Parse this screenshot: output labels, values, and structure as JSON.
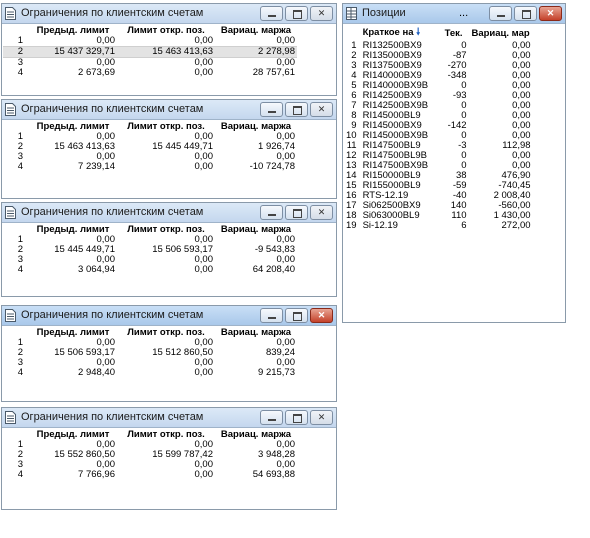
{
  "limit_windows": [
    {
      "title": "Ограничения по клиентским счетам",
      "headers": [
        "Предыд. лимит",
        "Лимит откр. поз.",
        "Вариац. маржа"
      ],
      "rows": [
        {
          "n": "1",
          "prev": "0,00",
          "open": "0,00",
          "var": "0,00"
        },
        {
          "n": "2",
          "prev": "15 437 329,71",
          "open": "15 463 413,63",
          "var": "2 278,98"
        },
        {
          "n": "3",
          "prev": "0,00",
          "open": "0,00",
          "var": "0,00"
        },
        {
          "n": "4",
          "prev": "2 673,69",
          "open": "0,00",
          "var": "28 757,61"
        }
      ]
    },
    {
      "title": "Ограничения по клиентским счетам",
      "headers": [
        "Предыд. лимит",
        "Лимит откр. поз.",
        "Вариац. маржа"
      ],
      "rows": [
        {
          "n": "1",
          "prev": "0,00",
          "open": "0,00",
          "var": "0,00"
        },
        {
          "n": "2",
          "prev": "15 463 413,63",
          "open": "15 445 449,71",
          "var": "1 926,74"
        },
        {
          "n": "3",
          "prev": "0,00",
          "open": "0,00",
          "var": "0,00"
        },
        {
          "n": "4",
          "prev": "7 239,14",
          "open": "0,00",
          "var": "-10 724,78"
        }
      ]
    },
    {
      "title": "Ограничения по клиентским счетам",
      "headers": [
        "Предыд. лимит",
        "Лимит откр. поз.",
        "Вариац. маржа"
      ],
      "rows": [
        {
          "n": "1",
          "prev": "0,00",
          "open": "0,00",
          "var": "0,00"
        },
        {
          "n": "2",
          "prev": "15 445 449,71",
          "open": "15 506 593,17",
          "var": "-9 543,83"
        },
        {
          "n": "3",
          "prev": "0,00",
          "open": "0,00",
          "var": "0,00"
        },
        {
          "n": "4",
          "prev": "3 064,94",
          "open": "0,00",
          "var": "64 208,40"
        }
      ]
    },
    {
      "title": "Ограничения по клиентским счетам",
      "headers": [
        "Предыд. лимит",
        "Лимит откр. поз.",
        "Вариац. маржа"
      ],
      "rows": [
        {
          "n": "1",
          "prev": "0,00",
          "open": "0,00",
          "var": "0,00"
        },
        {
          "n": "2",
          "prev": "15 506 593,17",
          "open": "15 512 860,50",
          "var": "839,24"
        },
        {
          "n": "3",
          "prev": "0,00",
          "open": "0,00",
          "var": "0,00"
        },
        {
          "n": "4",
          "prev": "2 948,40",
          "open": "0,00",
          "var": "9 215,73"
        }
      ]
    },
    {
      "title": "Ограничения по клиентским счетам",
      "headers": [
        "Предыд. лимит",
        "Лимит откр. поз.",
        "Вариац. маржа"
      ],
      "rows": [
        {
          "n": "1",
          "prev": "0,00",
          "open": "0,00",
          "var": "0,00"
        },
        {
          "n": "2",
          "prev": "15 552 860,50",
          "open": "15 599 787,42",
          "var": "3 948,28"
        },
        {
          "n": "3",
          "prev": "0,00",
          "open": "0,00",
          "var": "0,00"
        },
        {
          "n": "4",
          "prev": "7 766,96",
          "open": "0,00",
          "var": "54 693,88"
        }
      ]
    }
  ],
  "positions_window": {
    "title": "Позиции",
    "title_ellipsis": "...",
    "headers": [
      "Краткое на",
      "Тек.",
      "Вариац. мар"
    ],
    "sort_indicator": "🠗",
    "rows": [
      {
        "n": "1",
        "name": "RI132500BX9",
        "cur": "0",
        "var": "0,00"
      },
      {
        "n": "2",
        "name": "RI135000BX9",
        "cur": "-87",
        "var": "0,00"
      },
      {
        "n": "3",
        "name": "RI137500BX9",
        "cur": "-270",
        "var": "0,00"
      },
      {
        "n": "4",
        "name": "RI140000BX9",
        "cur": "-348",
        "var": "0,00"
      },
      {
        "n": "5",
        "name": "RI140000BX9B",
        "cur": "0",
        "var": "0,00"
      },
      {
        "n": "6",
        "name": "RI142500BX9",
        "cur": "-93",
        "var": "0,00"
      },
      {
        "n": "7",
        "name": "RI142500BX9B",
        "cur": "0",
        "var": "0,00"
      },
      {
        "n": "8",
        "name": "RI145000BL9",
        "cur": "0",
        "var": "0,00"
      },
      {
        "n": "9",
        "name": "RI145000BX9",
        "cur": "-142",
        "var": "0,00"
      },
      {
        "n": "10",
        "name": "RI145000BX9B",
        "cur": "0",
        "var": "0,00"
      },
      {
        "n": "11",
        "name": "RI147500BL9",
        "cur": "-3",
        "var": "112,98"
      },
      {
        "n": "12",
        "name": "RI147500BL9B",
        "cur": "0",
        "var": "0,00"
      },
      {
        "n": "13",
        "name": "RI147500BX9B",
        "cur": "0",
        "var": "0,00"
      },
      {
        "n": "14",
        "name": "RI150000BL9",
        "cur": "38",
        "var": "476,90"
      },
      {
        "n": "15",
        "name": "RI155000BL9",
        "cur": "-59",
        "var": "-740,45"
      },
      {
        "n": "16",
        "name": "RTS-12.19",
        "cur": "-40",
        "var": "2 008,40"
      },
      {
        "n": "17",
        "name": "Si062500BX9",
        "cur": "140",
        "var": "-560,00"
      },
      {
        "n": "18",
        "name": "Si063000BL9",
        "cur": "110",
        "var": "1 430,00"
      },
      {
        "n": "19",
        "name": "Si-12.19",
        "cur": "6",
        "var": "272,00"
      }
    ]
  },
  "window_controls": {
    "minimize": "—",
    "maximize": "▢",
    "close": "✕"
  },
  "icons": {
    "window_icon": "document-icon",
    "positions_icon": "table-icon"
  }
}
